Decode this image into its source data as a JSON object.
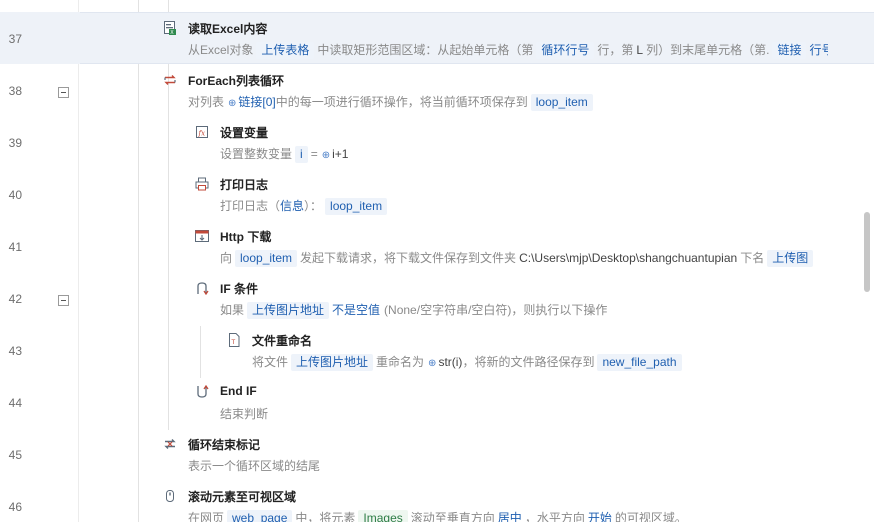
{
  "steps": [
    {
      "line": "37",
      "title": "读取Excel内容",
      "icon": "excel-read-icon",
      "desc": {
        "t1": "从Excel对象",
        "tag1": "上传表格",
        "t2": "中读取矩形范围区域：从起始单元格（第",
        "tag2": "循环行号",
        "t3": "行，第",
        "l": "L",
        "t4": "列）到末尾单元格（第.",
        "tag3": "链接",
        "t5": "行号"
      }
    },
    {
      "line": "38",
      "title": "ForEach列表循环",
      "icon": "loop-icon",
      "desc": {
        "t1": "对列表",
        "var1": "链接[0]",
        "t2": "中的每一项进行循环操作，将当前循环项保存到",
        "tag1": "loop_item"
      }
    },
    {
      "line": "39",
      "title": "设置变量",
      "icon": "variable-icon",
      "desc": {
        "t1": "设置整数变量",
        "tag1": "i",
        "t2": "=",
        "var1": "i+1"
      }
    },
    {
      "line": "40",
      "title": "打印日志",
      "icon": "printer-icon",
      "desc": {
        "t1": "打印日志（",
        "info": "信息",
        "t2": "）：",
        "tag1": "loop_item"
      }
    },
    {
      "line": "41",
      "title": "Http 下载",
      "icon": "download-icon",
      "desc": {
        "t1": "向",
        "tag1": "loop_item",
        "t2": "发起下载请求，将下载文件保存到文件夹",
        "path": "C:\\Users\\mjp\\Desktop\\shangchuantupian",
        "t3": "下名",
        "tag2": "上传图"
      }
    },
    {
      "line": "42",
      "title": "IF 条件",
      "icon": "if-branch-icon",
      "desc": {
        "t1": "如果",
        "tag1": "上传图片地址",
        "cond": "不是空值",
        "t2": "(None/空字符串/空白符)，则执行以下操作"
      }
    },
    {
      "line": "43",
      "title": "文件重命名",
      "icon": "file-rename-icon",
      "desc": {
        "t1": "将文件",
        "tag1": "上传图片地址",
        "t2": "重命名为",
        "var1": "str(i)",
        "t3": "，将新的文件路径保存到",
        "tag2": "new_file_path"
      }
    },
    {
      "line": "44",
      "title": "End IF",
      "icon": "end-if-icon",
      "desc": {
        "t1": "结束判断"
      }
    },
    {
      "line": "45",
      "title": "循环结束标记",
      "icon": "loop-end-icon",
      "desc": {
        "t1": "表示一个循环区域的结尾"
      }
    },
    {
      "line": "46",
      "title": "滚动元素至可视区域",
      "icon": "scroll-element-icon",
      "desc": {
        "t1": "在网页",
        "tag1": "web_page",
        "t2": "中，将元素",
        "tag2": "Images",
        "t3": "滚动至垂直方向",
        "v1": "居中",
        "t4": "，水平方向",
        "v2": "开始",
        "t5": "的可视区域。"
      }
    }
  ],
  "colors": {
    "selected_row": "#eef2f8",
    "tag_bg": "#eef3fa",
    "tag_text": "#1f5fb0",
    "element_tag_text": "#2e7d46"
  }
}
